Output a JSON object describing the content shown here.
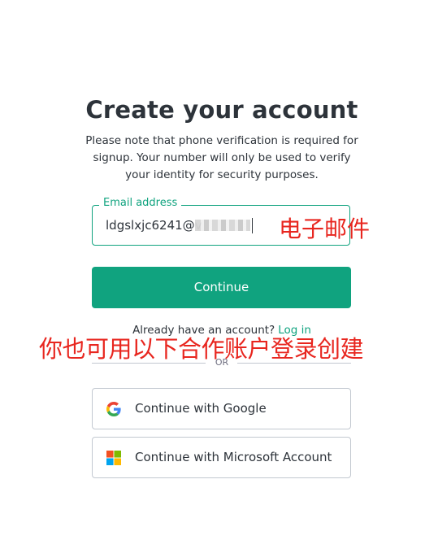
{
  "header": {
    "title": "Create your account",
    "note": "Please note that phone verification is required for signup. Your number will only be used to verify your identity for security purposes."
  },
  "form": {
    "email_label": "Email address",
    "email_value": "ldgslxjc6241@v",
    "continue_label": "Continue"
  },
  "login": {
    "prompt": "Already have an account?",
    "link_label": "Log in"
  },
  "divider": {
    "text": "OR"
  },
  "social": {
    "google_label": "Continue with Google",
    "microsoft_label": "Continue with Microsoft Account"
  },
  "annotations": {
    "email": "电子邮件",
    "alternatives": "你也可用以下合作账户登录创建"
  },
  "colors": {
    "brand": "#10a37f",
    "annotation": "#e8261f",
    "text": "#2d333a"
  }
}
